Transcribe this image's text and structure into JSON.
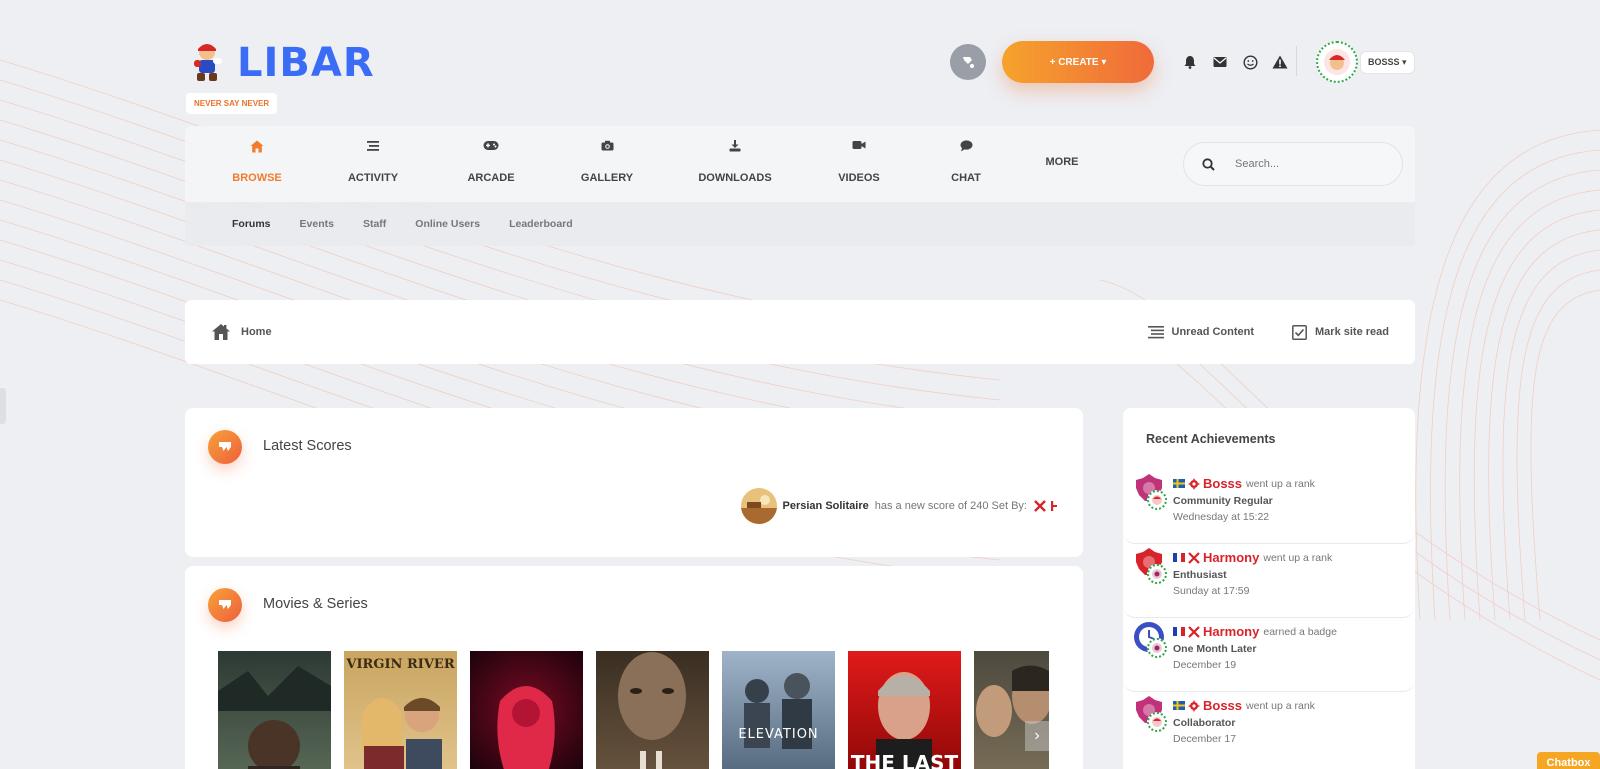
{
  "site": {
    "name": "LIBAR",
    "slogan": "NEVER SAY NEVER"
  },
  "header": {
    "create_label": "+ CREATE ▾",
    "user_label": "BOSSS ▾",
    "icons": [
      "paint-roller-icon",
      "bell-icon",
      "envelope-icon",
      "smile-icon",
      "warning-icon"
    ]
  },
  "nav": {
    "items": [
      {
        "label": "BROWSE",
        "icon": "home-icon",
        "active": true
      },
      {
        "label": "ACTIVITY",
        "icon": "list-icon"
      },
      {
        "label": "ARCADE",
        "icon": "gamepad-icon"
      },
      {
        "label": "GALLERY",
        "icon": "camera-icon"
      },
      {
        "label": "DOWNLOADS",
        "icon": "download-icon"
      },
      {
        "label": "VIDEOS",
        "icon": "video-icon"
      },
      {
        "label": "CHAT",
        "icon": "chat-icon"
      },
      {
        "label": "MORE",
        "icon": ""
      }
    ],
    "search_placeholder": "Search..."
  },
  "subnav": {
    "items": [
      "Forums",
      "Events",
      "Staff",
      "Online Users",
      "Leaderboard"
    ]
  },
  "breadcrumb": {
    "home": "Home",
    "unread": "Unread Content",
    "mark_read": "Mark site read"
  },
  "latest_scores": {
    "title": "Latest Scores",
    "game": "Persian Solitaire",
    "text": "has a new score of 240 Set By:"
  },
  "movies": {
    "title": "Movies & Series",
    "posters": [
      "",
      "VIRGIN RIVER",
      "",
      "",
      "ELEVATION",
      "THE LAST",
      ""
    ]
  },
  "achievements": {
    "title": "Recent Achievements",
    "items": [
      {
        "user": "Bosss",
        "action": "went up a rank",
        "rank": "Community Regular",
        "date": "Wednesday at 15:22",
        "flag": "se",
        "color": "#c0327a"
      },
      {
        "user": "Harmony",
        "action": "went up a rank",
        "rank": "Enthusiast",
        "date": "Sunday at 17:59",
        "flag": "fr",
        "color": "#d9232a"
      },
      {
        "user": "Harmony",
        "action": "earned a badge",
        "rank": "One Month Later",
        "date": "December 19",
        "flag": "fr",
        "color": "#3b4fc4"
      },
      {
        "user": "Bosss",
        "action": "went up a rank",
        "rank": "Collaborator",
        "date": "December 17",
        "flag": "se",
        "color": "#c0327a"
      }
    ]
  },
  "chatbox": {
    "label": "Chatbox"
  },
  "colors": {
    "accent": "#f17c2f",
    "brand": "#3b6cf5",
    "username": "#d9232a"
  }
}
